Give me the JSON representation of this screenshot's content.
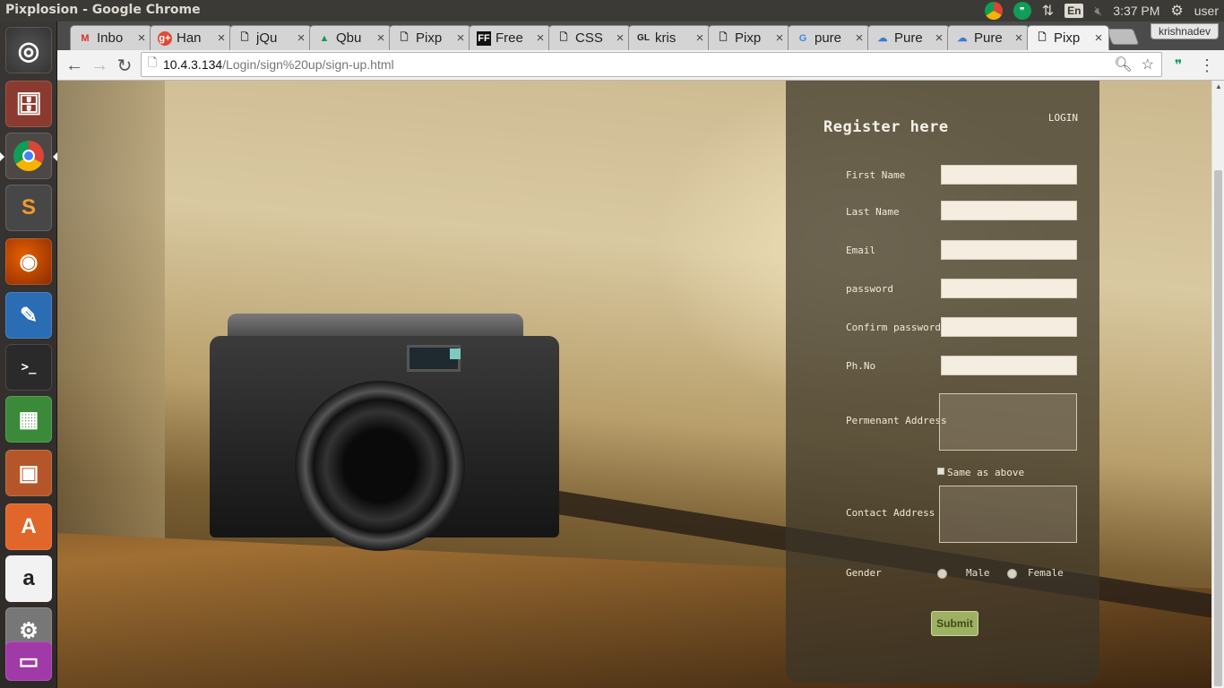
{
  "window": {
    "title": "Pixplosion - Google Chrome"
  },
  "tray": {
    "lang": "En",
    "time": "3:37 PM",
    "user": "user"
  },
  "browser": {
    "profile": "krishnadev",
    "tabs": [
      {
        "label": "Inbo",
        "favicon": "gmail-icon"
      },
      {
        "label": "Han",
        "favicon": "google-plus-icon"
      },
      {
        "label": "jQu",
        "favicon": "page-icon"
      },
      {
        "label": "Qbu",
        "favicon": "google-drive-icon"
      },
      {
        "label": "Pixp",
        "favicon": "page-icon"
      },
      {
        "label": "Free",
        "favicon": "ff-icon"
      },
      {
        "label": "CSS",
        "favicon": "page-icon"
      },
      {
        "label": "kris",
        "favicon": "gl-icon"
      },
      {
        "label": "Pixp",
        "favicon": "page-icon"
      },
      {
        "label": "pure",
        "favicon": "google-icon"
      },
      {
        "label": "Pure",
        "favicon": "cloud-icon"
      },
      {
        "label": "Pure",
        "favicon": "cloud-icon"
      },
      {
        "label": "Pixp",
        "favicon": "page-icon"
      }
    ],
    "url_host": "10.4.3.134",
    "url_path": "/Login/sign%20up/sign-up.html"
  },
  "form": {
    "title": "Register here",
    "login_link": "LOGIN",
    "first_name_label": "First Name",
    "last_name_label": "Last Name",
    "email_label": "Email",
    "password_label": "password",
    "confirm_password_label": "Confirm password",
    "phone_label": "Ph.No",
    "perm_address_label": "Permenant Address",
    "same_as_above_label": "Same as above",
    "contact_address_label": "Contact Address",
    "gender_label": "Gender",
    "male_label": "Male",
    "female_label": "Female",
    "submit_label": "Submit"
  }
}
